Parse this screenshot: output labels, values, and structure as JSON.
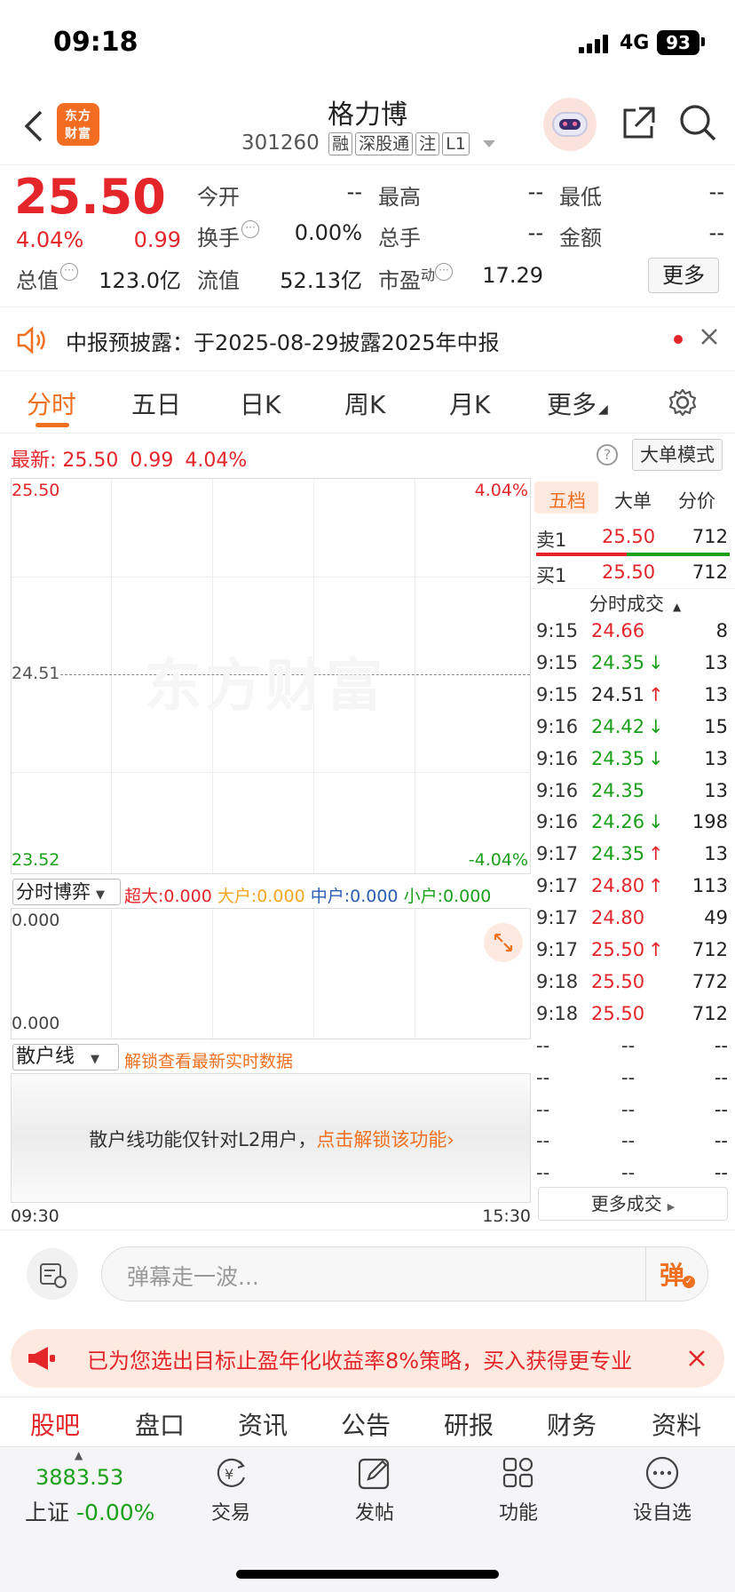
{
  "status": {
    "time": "09:18",
    "network": "4G",
    "battery": "93"
  },
  "header": {
    "name": "格力博",
    "code": "301260",
    "tags": [
      "融",
      "深股通",
      "注",
      "L1"
    ],
    "logo_text": "东方财富"
  },
  "quote": {
    "price": "25.50",
    "change_pct": "4.04%",
    "change": "0.99",
    "open_label": "今开",
    "open": "--",
    "high_label": "最高",
    "high": "--",
    "low_label": "最低",
    "low": "--",
    "turnover_label": "换手",
    "turnover": "0.00%",
    "volume_label": "总手",
    "volume": "--",
    "amount_label": "金额",
    "amount": "--",
    "mcap_label": "总值",
    "mcap": "123.0亿",
    "float_label": "流值",
    "float": "52.13亿",
    "pe_label": "市盈",
    "pe_sup": "动",
    "pe": "17.29",
    "more_label": "更多"
  },
  "notice": {
    "text": "中报预披露：于2025-08-29披露2025年中报"
  },
  "tabs": [
    "分时",
    "五日",
    "日K",
    "周K",
    "月K",
    "更多"
  ],
  "latest": {
    "label": "最新:",
    "price": "25.50",
    "change": "0.99",
    "pct": "4.04%",
    "mode_label": "大单模式"
  },
  "chart": {
    "y_top": "25.50",
    "y_mid": "24.51",
    "y_bottom": "23.52",
    "pct_top": "4.04%",
    "pct_bottom": "-4.04%",
    "watermark": "东方财富",
    "time_start": "09:30",
    "time_end": "15:30"
  },
  "game": {
    "select": "分时博弈",
    "super_label": "超大:",
    "super": "0.000",
    "big_label": "大户:",
    "big": "0.000",
    "mid_label": "中户:",
    "mid": "0.000",
    "small_label": "小户:",
    "small": "0.000",
    "val_top": "0.000",
    "val_bottom": "0.000"
  },
  "retail": {
    "select": "散户线",
    "unlock_hint": "解锁查看最新实时数据",
    "lock_text": "散户线功能仅针对L2用户，",
    "lock_link": "点击解锁该功能"
  },
  "side": {
    "tabs": [
      "五档",
      "大单",
      "分价"
    ],
    "sell1": {
      "label": "卖1",
      "price": "25.50",
      "vol": "712"
    },
    "buy1": {
      "label": "买1",
      "price": "25.50",
      "vol": "712"
    },
    "ticks_title": "分时成交",
    "ticks": [
      {
        "t": "9:15",
        "p": "24.66",
        "v": "8",
        "c": "red",
        "a": ""
      },
      {
        "t": "9:15",
        "p": "24.35",
        "v": "13",
        "c": "green",
        "a": "↓"
      },
      {
        "t": "9:15",
        "p": "24.51",
        "v": "13",
        "c": "black",
        "a": "↑"
      },
      {
        "t": "9:16",
        "p": "24.42",
        "v": "15",
        "c": "green",
        "a": "↓"
      },
      {
        "t": "9:16",
        "p": "24.35",
        "v": "13",
        "c": "green",
        "a": "↓"
      },
      {
        "t": "9:16",
        "p": "24.35",
        "v": "13",
        "c": "green",
        "a": ""
      },
      {
        "t": "9:16",
        "p": "24.26",
        "v": "198",
        "c": "green",
        "a": "↓"
      },
      {
        "t": "9:17",
        "p": "24.35",
        "v": "13",
        "c": "green",
        "a": "↑"
      },
      {
        "t": "9:17",
        "p": "24.80",
        "v": "113",
        "c": "red",
        "a": "↑"
      },
      {
        "t": "9:17",
        "p": "24.80",
        "v": "49",
        "c": "red",
        "a": ""
      },
      {
        "t": "9:17",
        "p": "25.50",
        "v": "712",
        "c": "red",
        "a": "↑"
      },
      {
        "t": "9:18",
        "p": "25.50",
        "v": "772",
        "c": "red",
        "a": ""
      },
      {
        "t": "9:18",
        "p": "25.50",
        "v": "712",
        "c": "red",
        "a": ""
      },
      {
        "t": "--",
        "p": "--",
        "v": "--",
        "c": "black",
        "a": ""
      },
      {
        "t": "--",
        "p": "--",
        "v": "--",
        "c": "black",
        "a": ""
      },
      {
        "t": "--",
        "p": "--",
        "v": "--",
        "c": "black",
        "a": ""
      },
      {
        "t": "--",
        "p": "--",
        "v": "--",
        "c": "black",
        "a": ""
      },
      {
        "t": "--",
        "p": "--",
        "v": "--",
        "c": "black",
        "a": ""
      }
    ],
    "more_ticks": "更多成交"
  },
  "comment": {
    "placeholder": "弹幕走一波...",
    "send": "弹"
  },
  "ad": {
    "text": "已为您选出目标止盈年化收益率8%策略，买入获得更专业"
  },
  "subtabs": [
    "股吧",
    "盘口",
    "资讯",
    "公告",
    "研报",
    "财务",
    "资料"
  ],
  "bottom": {
    "index_value": "3883.53",
    "index_name": "上证",
    "index_change": "-0.00%",
    "items": [
      "交易",
      "发帖",
      "功能",
      "设自选"
    ]
  },
  "colors": {
    "up": "#e4262b",
    "down": "#1aa01a",
    "accent": "#f07020"
  }
}
